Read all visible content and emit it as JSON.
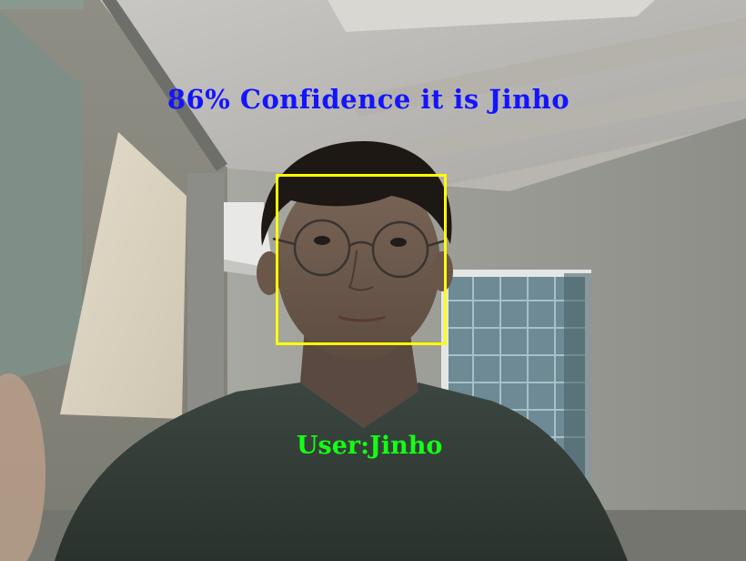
{
  "overlay": {
    "confidence_text": "86% Confidence it is Jinho",
    "user_text": "User:Jinho"
  },
  "colors": {
    "confidence_text": "#1414ff",
    "face_box": "#ffff00",
    "user_text": "#14ff14"
  }
}
